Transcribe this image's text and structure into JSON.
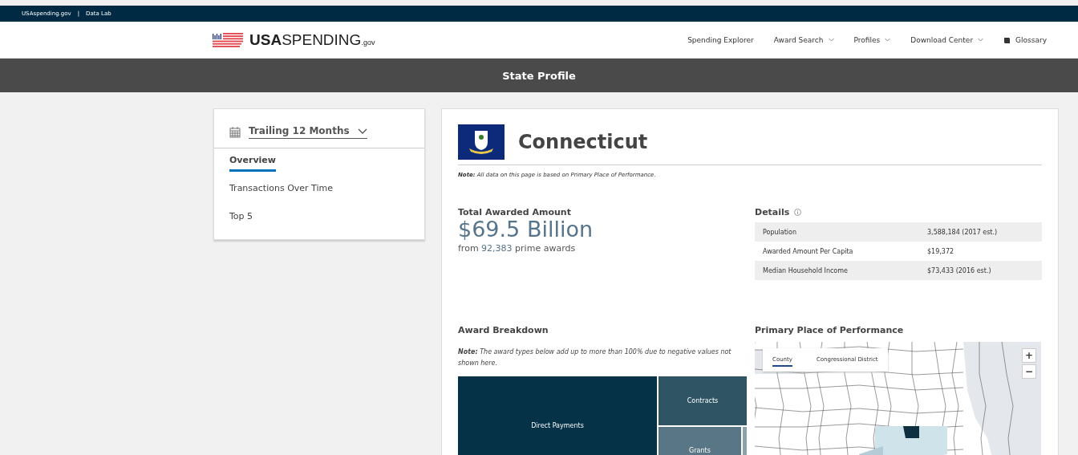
{
  "top_bar": {
    "links": [
      "USAspending.gov",
      "Data Lab"
    ],
    "separator": "|"
  },
  "header": {
    "logo": {
      "bold": "USA",
      "light": "SPENDING",
      "suffix": ".gov"
    },
    "nav": [
      {
        "label": "Spending Explorer",
        "kind": "link"
      },
      {
        "label": "Award Search",
        "kind": "dropdown"
      },
      {
        "label": "Profiles",
        "kind": "dropdown"
      },
      {
        "label": "Download Center",
        "kind": "dropdown"
      },
      {
        "label": "Glossary",
        "kind": "glossary"
      }
    ]
  },
  "banner": {
    "title": "State Profile"
  },
  "sidebar": {
    "period": "Trailing 12 Months",
    "items": [
      {
        "label": "Overview",
        "selected": true
      },
      {
        "label": "Transactions Over Time",
        "selected": false
      },
      {
        "label": "Top 5",
        "selected": false
      }
    ]
  },
  "profile": {
    "state": "Connecticut",
    "note": "**Note:** All data on this page is based on Primary Place of Performance.",
    "total": {
      "label": "Total Awarded Amount",
      "amount": "$69.5 Billion",
      "prefix": "from",
      "count": "92,383",
      "suffix": "prime awards"
    },
    "details": {
      "title": "Details",
      "rows": [
        {
          "label": "Population",
          "value": "3,588,184 (2017 est.)"
        },
        {
          "label": "Awarded Amount Per Capita",
          "value": "$19,372"
        },
        {
          "label": "Median Household Income",
          "value": "$73,433 (2016 est.)"
        }
      ]
    },
    "breakdown": {
      "title": "Award Breakdown",
      "note": "**Note:** The award types below add up to more than 100% due to negative values not shown here.",
      "tiles": [
        {
          "label": "Direct Payments",
          "color": "#063247"
        },
        {
          "label": "Contracts",
          "color": "#2f5565"
        },
        {
          "label": "Grants",
          "color": "#587685"
        },
        {
          "color": "#8ca3ae"
        }
      ]
    },
    "map": {
      "title": "Primary Place of Performance",
      "tabs": [
        {
          "label": "County",
          "selected": true
        },
        {
          "label": "Congressional District",
          "selected": false
        }
      ],
      "zoom": [
        "+",
        "−"
      ]
    }
  }
}
